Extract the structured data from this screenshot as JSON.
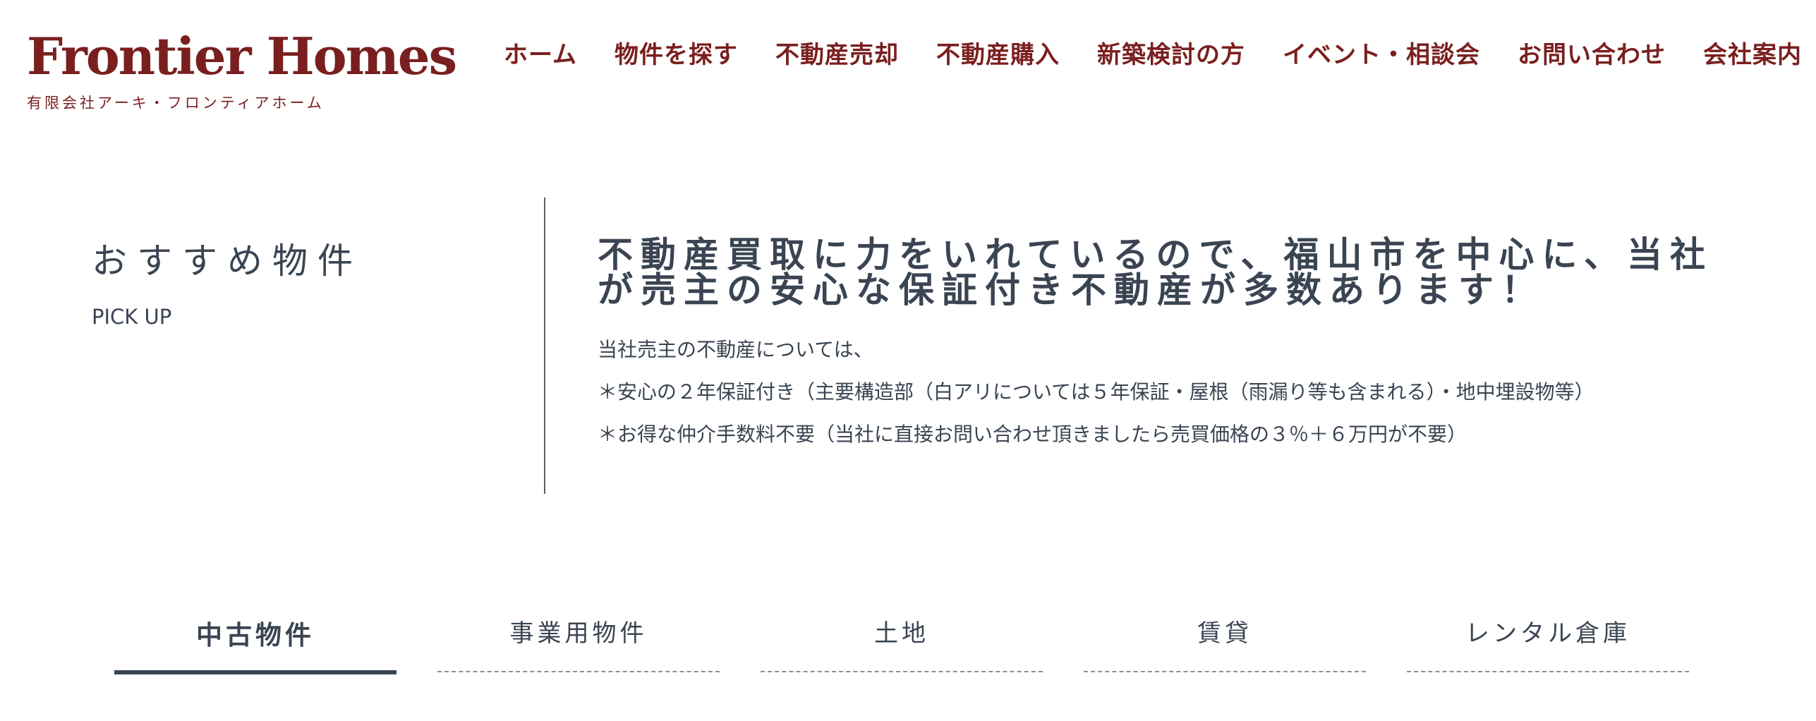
{
  "logo": {
    "main": "Frontier Homes",
    "sub": "有限会社アーキ・フロンティアホーム"
  },
  "nav": {
    "items": [
      {
        "label": "ホーム"
      },
      {
        "label": "物件を探す"
      },
      {
        "label": "不動産売却"
      },
      {
        "label": "不動産購入"
      },
      {
        "label": "新築検討の方"
      },
      {
        "label": "イベント・相談会"
      },
      {
        "label": "お問い合わせ"
      },
      {
        "label": "会社案内"
      }
    ]
  },
  "pickup": {
    "title": "おすすめ物件",
    "subtitle": "PICK UP",
    "lead_lines": [
      "不動産買取に力をいれているので、福山市を中心に、当社",
      "が売主の安心な保証付き不動産が多数あります！"
    ],
    "desc": [
      "当社売主の不動産については、",
      "＊安心の２年保証付き（主要構造部（白アリについては５年保証・屋根（雨漏り等も含まれる）・地中埋設物等）",
      "＊お得な仲介手数料不要（当社に直接お問い合わせ頂きましたら売買価格の３％＋６万円が不要）"
    ]
  },
  "tabs": {
    "items": [
      {
        "label": "中古物件",
        "active": true
      },
      {
        "label": "事業用物件",
        "active": false
      },
      {
        "label": "土地",
        "active": false
      },
      {
        "label": "賃貸",
        "active": false
      },
      {
        "label": "レンタル倉庫",
        "active": false
      }
    ]
  },
  "colors": {
    "brand": "#7a1f1f",
    "text": "#3a4452",
    "background": "#ffffff"
  }
}
